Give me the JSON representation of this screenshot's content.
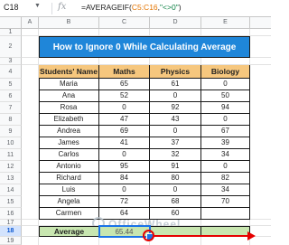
{
  "formula_bar": {
    "name_box": "C18",
    "fx": "fx",
    "formula_prefix": "=AVERAGEIF(",
    "formula_ref": "C5:C16",
    "formula_mid": ",",
    "formula_str": "\"<>0\"",
    "formula_suffix": ")"
  },
  "columns": [
    "A",
    "B",
    "C",
    "D",
    "E"
  ],
  "rows": [
    "1",
    "2",
    "3",
    "4",
    "5",
    "6",
    "7",
    "8",
    "9",
    "10",
    "11",
    "12",
    "13",
    "14",
    "15",
    "16",
    "17",
    "18",
    "19"
  ],
  "title": "How to Ignore 0 While Calculating Average",
  "table": {
    "headers": [
      "Students' Name",
      "Maths",
      "Physics",
      "Biology"
    ],
    "rows": [
      [
        "Maria",
        "65",
        "61",
        "0"
      ],
      [
        "Ana",
        "52",
        "0",
        "50"
      ],
      [
        "Rosa",
        "0",
        "92",
        "94"
      ],
      [
        "Elizabeth",
        "47",
        "43",
        "0"
      ],
      [
        "Andrea",
        "69",
        "0",
        "67"
      ],
      [
        "James",
        "41",
        "37",
        "39"
      ],
      [
        "Carlos",
        "0",
        "32",
        "34"
      ],
      [
        "Antonio",
        "95",
        "91",
        "0"
      ],
      [
        "Richard",
        "84",
        "80",
        "82"
      ],
      [
        "Luis",
        "0",
        "0",
        "34"
      ],
      [
        "Angela",
        "72",
        "68",
        "70"
      ],
      [
        "Carmen",
        "64",
        "60",
        ""
      ]
    ]
  },
  "average": {
    "label": "Average",
    "value": "65.44"
  },
  "watermark": "OfficeWheel",
  "colors": {
    "title_bg": "#1f86d9",
    "header_bg": "#f6c77e",
    "average_bg": "#c8e6b0",
    "selection": "#1a73e8",
    "annotation": "#e60000"
  }
}
